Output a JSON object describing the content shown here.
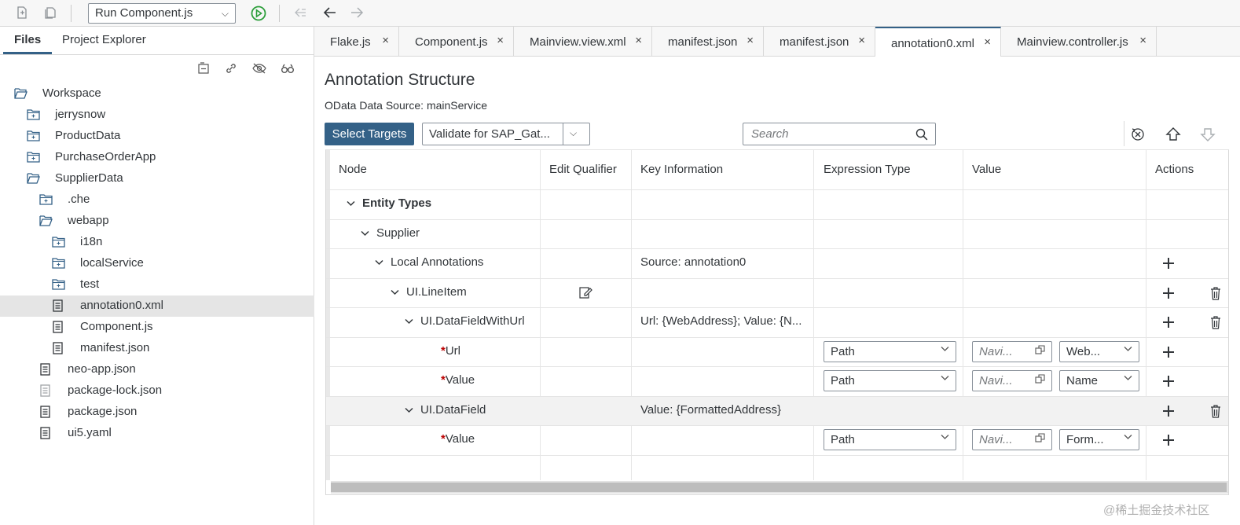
{
  "toolbar": {
    "run_select": "Run Component.js"
  },
  "left_panel": {
    "tabs": [
      "Files",
      "Project Explorer"
    ],
    "tree": [
      {
        "label": "Workspace",
        "type": "folder-open"
      },
      {
        "label": "jerrysnow",
        "type": "folder"
      },
      {
        "label": "ProductData",
        "type": "folder"
      },
      {
        "label": "PurchaseOrderApp",
        "type": "folder"
      },
      {
        "label": "SupplierData",
        "type": "folder-open"
      },
      {
        "label": ".che",
        "type": "folder"
      },
      {
        "label": "webapp",
        "type": "folder-open"
      },
      {
        "label": "i18n",
        "type": "folder"
      },
      {
        "label": "localService",
        "type": "folder"
      },
      {
        "label": "test",
        "type": "folder"
      },
      {
        "label": "annotation0.xml",
        "type": "file",
        "selected": true
      },
      {
        "label": "Component.js",
        "type": "file"
      },
      {
        "label": "manifest.json",
        "type": "file"
      },
      {
        "label": "neo-app.json",
        "type": "file"
      },
      {
        "label": "package-lock.json",
        "type": "file-light"
      },
      {
        "label": "package.json",
        "type": "file"
      },
      {
        "label": "ui5.yaml",
        "type": "file"
      }
    ]
  },
  "editor_tabs": [
    {
      "label": "Flake.js"
    },
    {
      "label": "Component.js"
    },
    {
      "label": "Mainview.view.xml"
    },
    {
      "label": "manifest.json"
    },
    {
      "label": "manifest.json"
    },
    {
      "label": "annotation0.xml",
      "active": true
    },
    {
      "label": "Mainview.controller.js"
    }
  ],
  "annotation": {
    "title": "Annotation Structure",
    "source": "OData Data Source: mainService",
    "select_targets": "Select Targets",
    "validate": "Validate for SAP_Gat...",
    "search_placeholder": "Search"
  },
  "table": {
    "headers": [
      "Node",
      "Edit Qualifier",
      "Key Information",
      "Expression Type",
      "Value",
      "Actions"
    ],
    "rows": [
      {
        "node": "Entity Types",
        "bold": true
      },
      {
        "node": "Supplier"
      },
      {
        "node": "Local Annotations",
        "key": "Source: annotation0"
      },
      {
        "node": "UI.LineItem"
      },
      {
        "node": "UI.DataFieldWithUrl",
        "key": "Url: {WebAddress}; Value: {N..."
      },
      {
        "node": "Url",
        "required": true,
        "expr": "Path",
        "nav": "Navi...",
        "val": "Web..."
      },
      {
        "node": "Value",
        "required": true,
        "expr": "Path",
        "nav": "Navi...",
        "val": "Name"
      },
      {
        "node": "UI.DataField",
        "key": "Value: {FormattedAddress}"
      },
      {
        "node": "Value",
        "required": true,
        "expr": "Path",
        "nav": "Navi...",
        "val": "Form..."
      }
    ]
  },
  "watermark": "@稀土掘金技术社区"
}
